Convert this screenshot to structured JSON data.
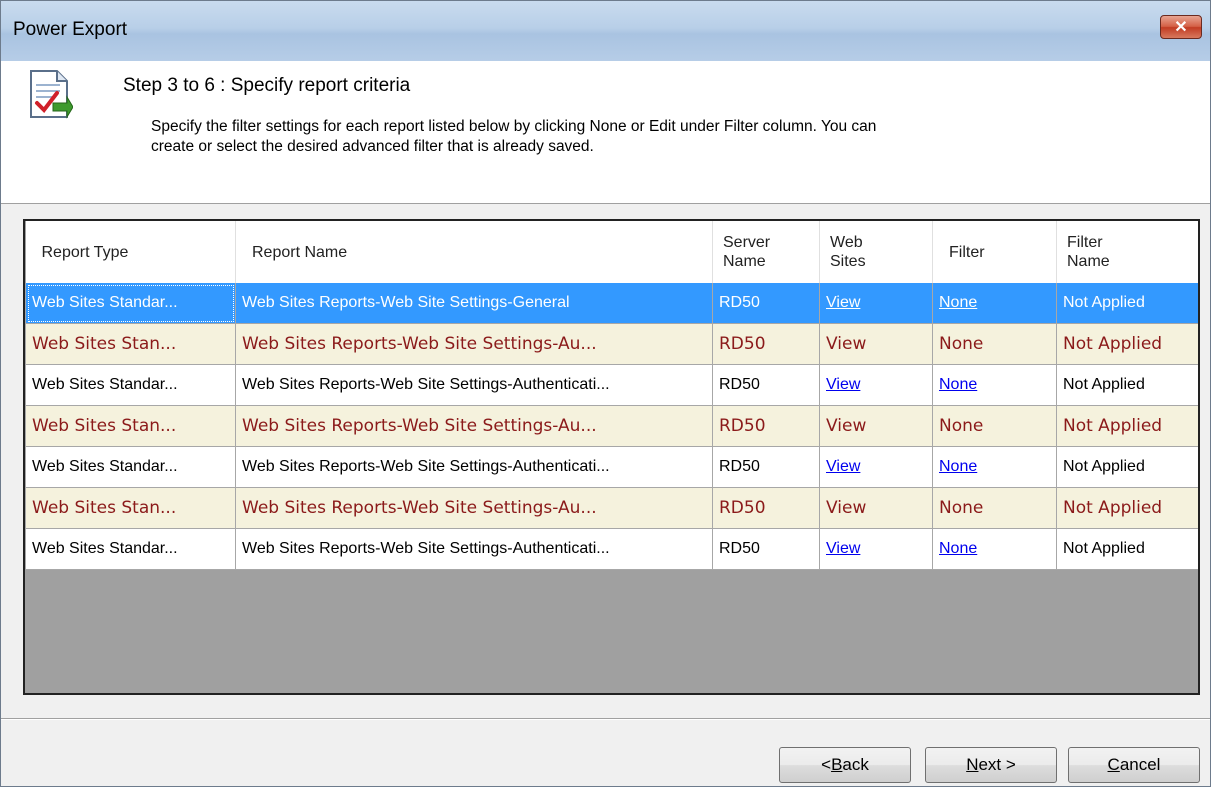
{
  "window": {
    "title": "Power Export",
    "close_glyph": "✕"
  },
  "header": {
    "icon": "report-check-icon",
    "title": "Step 3 to 6 : Specify report criteria",
    "description_line1": "Specify the filter settings for each report listed below by clicking None or Edit under Filter column. You can",
    "description_line2": "create or select the desired advanced filter that is already saved."
  },
  "grid": {
    "columns": {
      "report_type": "Report Type",
      "report_name": "Report Name",
      "server_name_1": "Server",
      "server_name_2": "Name",
      "web_sites_1": "Web",
      "web_sites_2": "Sites",
      "filter": "Filter",
      "filter_name_1": "Filter",
      "filter_name_2": "Name"
    },
    "rows": [
      {
        "report_type": "Web Sites Standar...",
        "report_name": "Web Sites Reports-Web Site Settings-General",
        "server": "RD50",
        "web_sites": "View",
        "filter": "None",
        "filter_name": "Not Applied"
      },
      {
        "report_type": "Web Sites Stan...",
        "report_name": "Web Sites Reports-Web Site Settings-Au...",
        "server": "RD50",
        "web_sites": "View",
        "filter": "None",
        "filter_name": "Not Applied"
      },
      {
        "report_type": "Web Sites Standar...",
        "report_name": "Web Sites Reports-Web Site Settings-Authenticati...",
        "server": "RD50",
        "web_sites": "View",
        "filter": "None",
        "filter_name": "Not Applied"
      },
      {
        "report_type": "Web Sites Stan...",
        "report_name": "Web Sites Reports-Web Site Settings-Au...",
        "server": "RD50",
        "web_sites": "View",
        "filter": "None",
        "filter_name": "Not Applied"
      },
      {
        "report_type": "Web Sites Standar...",
        "report_name": "Web Sites Reports-Web Site Settings-Authenticati...",
        "server": "RD50",
        "web_sites": "View",
        "filter": "None",
        "filter_name": "Not Applied"
      },
      {
        "report_type": "Web Sites Stan...",
        "report_name": "Web Sites Reports-Web Site Settings-Au...",
        "server": "RD50",
        "web_sites": "View",
        "filter": "None",
        "filter_name": "Not Applied"
      },
      {
        "report_type": "Web Sites Standar...",
        "report_name": "Web Sites Reports-Web Site Settings-Authenticati...",
        "server": "RD50",
        "web_sites": "View",
        "filter": "None",
        "filter_name": "Not Applied"
      }
    ]
  },
  "buttons": {
    "back_prefix": "<",
    "back_ul": "B",
    "back_rest": "ack",
    "next_ul": "N",
    "next_rest": "ext >",
    "cancel_ul": "C",
    "cancel_rest": "ancel"
  },
  "colors": {
    "selection": "#3399ff",
    "alt_row_bg": "#f5f2dd",
    "alt_row_text": "#8b1a1a",
    "link": "#0000ee"
  }
}
